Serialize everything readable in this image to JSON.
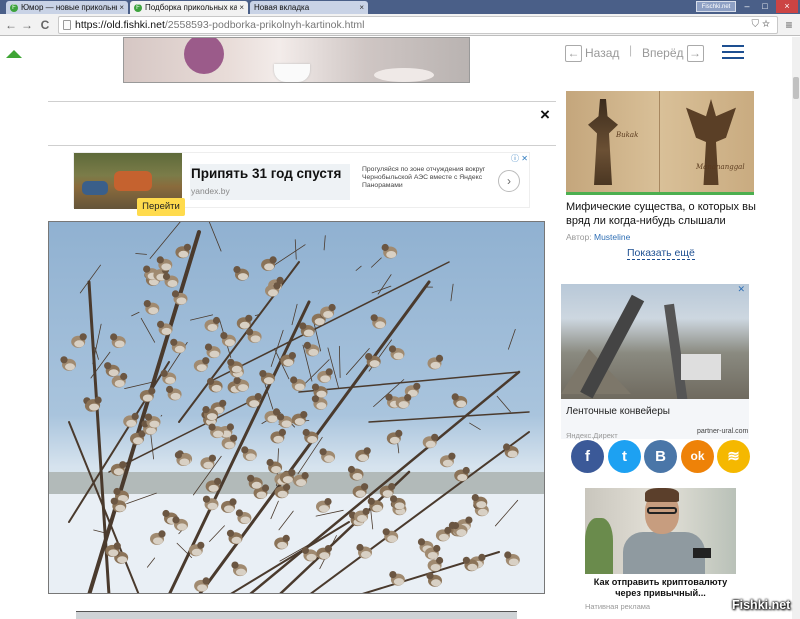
{
  "browser": {
    "tabs": [
      {
        "label": "Юмор — новые прикольные...",
        "close": "×",
        "active": false
      },
      {
        "label": "Подборка прикольных кар",
        "close": "×",
        "active": true
      },
      {
        "label": "Новая вкладка",
        "close": "×",
        "active": false
      }
    ],
    "window_user": "Fischki.net",
    "window_buttons": {
      "minimize": "–",
      "maximize": "□",
      "close": "×"
    },
    "nav": {
      "back": "←",
      "forward": "→",
      "reload": "C",
      "menu": "≡"
    },
    "url": {
      "host": "https://old.fishki.net",
      "path": "/2558593-podborka-prikolnyh-kartinok.html"
    }
  },
  "page": {
    "close_symbol": "×",
    "ad_banner": {
      "title": "Припять 31 год спустя",
      "domain": "yandex.by",
      "body": "Прогуляйся по зоне отчуждения вокруг Чернобыльской АЭС вместе с Яндекс Панорамами",
      "arrow": "›",
      "icons": "ⓘ ✕"
    },
    "sidebar": {
      "nav_prev": "Назад",
      "nav_next": "Вперёд",
      "nav_sep": "|",
      "card1": {
        "title": "Мифические существа, о которых вы вряд ли когда-нибудь слышали",
        "author_prefix": "Автор:",
        "author": "Musteline",
        "caption1": "Bukak",
        "caption2": "Manananggal"
      },
      "show_more": "Показать ещё",
      "card2": {
        "text": "Ленточные конвейеры",
        "button": "Перейти",
        "domain": "partner-ural.com",
        "close": "✕",
        "yandex_label": "Яндекс.Директ"
      },
      "social": [
        {
          "name": "facebook",
          "glyph": "f",
          "color": "#3b5998"
        },
        {
          "name": "twitter",
          "glyph": "t",
          "color": "#1da1f2"
        },
        {
          "name": "vkontakte",
          "glyph": "B",
          "color": "#4a76a8"
        },
        {
          "name": "odnoklassniki",
          "glyph": "ok",
          "color": "#ee8208"
        },
        {
          "name": "rss",
          "glyph": "≋",
          "color": "#f5b800"
        }
      ],
      "card3": {
        "title": "Как отправить криптовалюту через привычный...",
        "label": "Нативная реклама"
      }
    },
    "watermark": "Fishki.net"
  }
}
